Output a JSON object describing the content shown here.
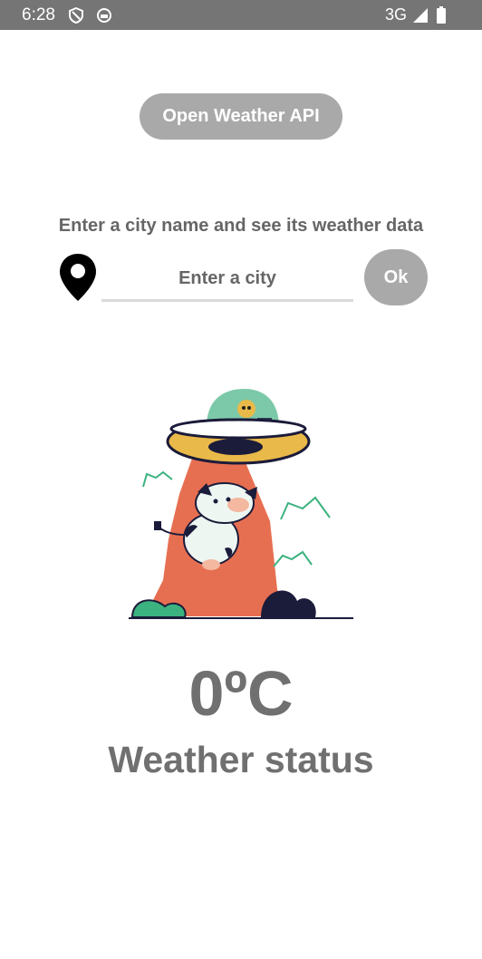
{
  "status_bar": {
    "time": "6:28",
    "network": "3G",
    "icons": [
      "shield-icon",
      "circle-app-icon",
      "signal-icon",
      "battery-icon"
    ]
  },
  "header": {
    "api_button_label": "Open Weather API"
  },
  "search": {
    "instructions": "Enter a city name and see its weather data",
    "placeholder": "Enter a city",
    "ok_label": "Ok"
  },
  "weather": {
    "temperature": "0ºC",
    "status": "Weather status"
  },
  "colors": {
    "status_bar": "#757575",
    "button_bg": "#a9a9a9",
    "text": "#707070",
    "beam": "#e76f51",
    "ufo_dome": "#7cc9a9",
    "ufo_disc": "#e9b949"
  }
}
